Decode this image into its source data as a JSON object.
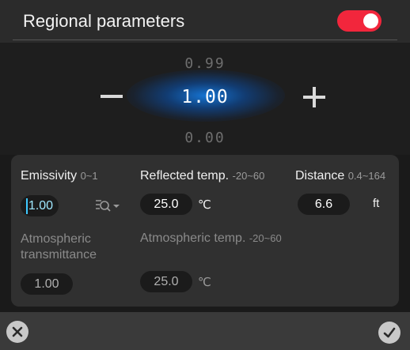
{
  "header": {
    "title": "Regional parameters",
    "toggle_on": true,
    "toggle_color": "#f2263c"
  },
  "picker": {
    "previous_value": "0.99",
    "current_value": "1.00",
    "next_value": "0.00",
    "minus_icon": "minus-icon",
    "plus_icon": "plus-icon"
  },
  "params": {
    "emissivity": {
      "label": "Emissivity",
      "range": "0~1",
      "value": "1.00",
      "dropdown_icon": "magnifier-dropdown-icon"
    },
    "reflected_temp": {
      "label": "Reflected temp.",
      "range": "-20~60",
      "value": "25.0",
      "unit": "℃"
    },
    "distance": {
      "label": "Distance",
      "range": "0.4~164",
      "value": "6.6",
      "unit": "ft"
    },
    "atmospheric_transmittance": {
      "label_line1": "Atmospheric",
      "label_line2": "transmittance",
      "value": "1.00"
    },
    "atmospheric_temp": {
      "label": "Atmospheric temp.",
      "range": "-20~60",
      "value": "25.0",
      "unit": "℃"
    }
  },
  "footer": {
    "cancel_icon": "close-icon",
    "confirm_icon": "check-icon"
  }
}
